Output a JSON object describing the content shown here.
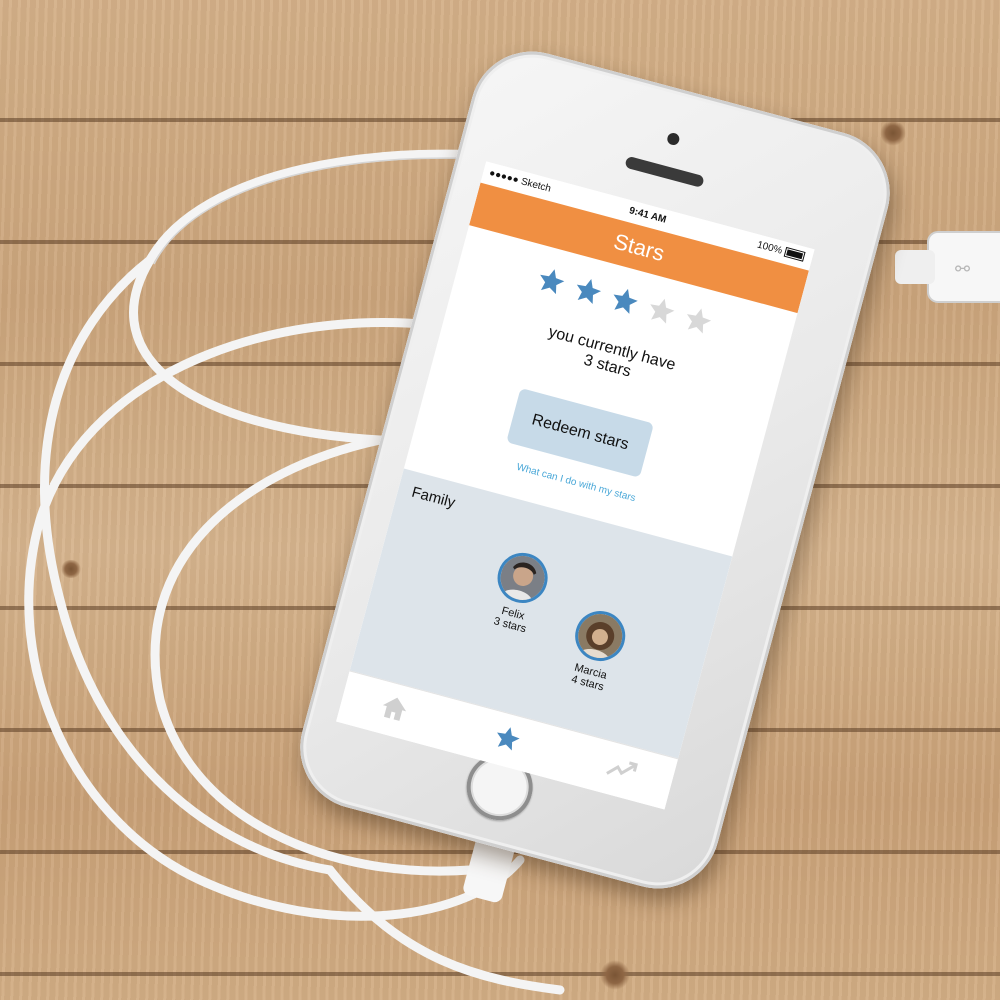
{
  "status_bar": {
    "carrier": "●●●●● Sketch",
    "time": "9:41 AM",
    "battery": "100%"
  },
  "nav": {
    "title": "Stars"
  },
  "rating": {
    "value": 3,
    "max": 5,
    "filled_color": "#4a89be",
    "empty_color": "#d8d8d8"
  },
  "balance": {
    "line1": "you currently have",
    "line2": "3 stars"
  },
  "redeem_button": {
    "label": "Redeem stars"
  },
  "help_link": {
    "label": "What can I do with my stars"
  },
  "family": {
    "title": "Family",
    "members": [
      {
        "name": "Felix",
        "stars": "3 stars"
      },
      {
        "name": "Marcia",
        "stars": "4 stars"
      }
    ]
  },
  "tabs": [
    {
      "icon": "home-icon",
      "active": false
    },
    {
      "icon": "star-icon",
      "active": true
    },
    {
      "icon": "trend-icon",
      "active": false
    }
  ],
  "colors": {
    "accent": "#f08f42",
    "active_tab": "#4a89be",
    "family_bg": "#dde4ea"
  }
}
